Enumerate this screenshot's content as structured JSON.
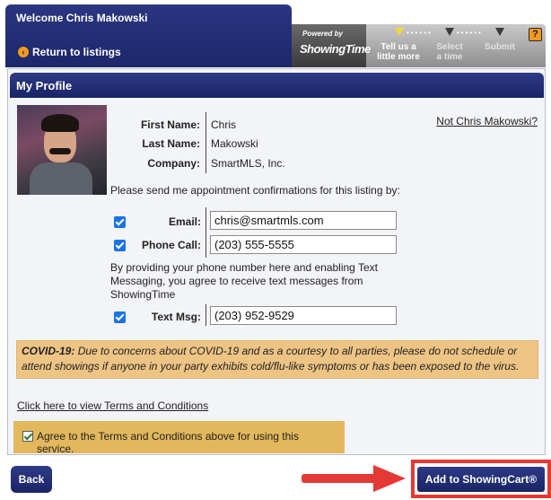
{
  "header": {
    "welcome": "Welcome Chris Makowski",
    "return_link": "Return to listings",
    "powered_by": "Powered by",
    "brand": "ShowingTime",
    "steps": [
      {
        "label": "Tell us a little more",
        "line1": "Tell us a",
        "line2": "little more",
        "active": true
      },
      {
        "label": "Select a time",
        "line1": "Select",
        "line2": "a time",
        "active": false
      },
      {
        "label": "Submit",
        "line1": "Submit",
        "line2": "",
        "active": false
      }
    ],
    "help": "?"
  },
  "profile": {
    "title": "My Profile",
    "first_name_label": "First Name:",
    "first_name": "Chris",
    "last_name_label": "Last Name:",
    "last_name": "Makowski",
    "company_label": "Company:",
    "company": "SmartMLS, Inc.",
    "not_user_link": "Not Chris Makowski?",
    "instructions": "Please send me appointment confirmations for this listing by:",
    "email_label": "Email:",
    "email_value": "chris@smartmls.com",
    "email_checked": true,
    "phone_label": "Phone Call:",
    "phone_value": "(203) 555-5555",
    "phone_checked": true,
    "disclaimer": "By providing your phone number here and enabling Text Messaging, you agree to receive text messages from ShowingTime",
    "text_label": "Text Msg:",
    "text_value": "(203) 952-9529",
    "text_checked": true,
    "covid_label": "COVID-19:",
    "covid_text": "Due to concerns about COVID-19 and as a courtesy to all parties, please do not schedule or attend showings if anyone in your party exhibits cold/flu-like symptoms or has been exposed to the virus.",
    "terms_link": "Click here to view Terms and Conditions",
    "agree_text": "Agree to the Terms and Conditions above for using this service.",
    "agree_checked": true
  },
  "footer": {
    "back": "Back",
    "add": "Add to ShowingCart®"
  },
  "colors": {
    "navy": "#1f2a6b",
    "covid_bg": "#eec484",
    "agree_bg": "#e3b85c",
    "highlight_red": "#e53935"
  }
}
